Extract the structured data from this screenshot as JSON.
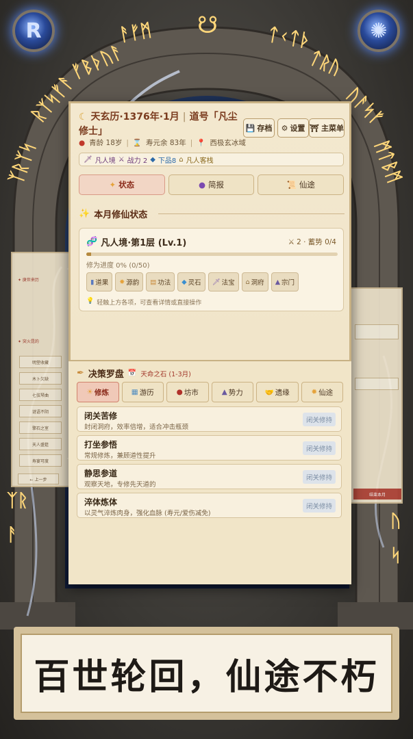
{
  "header": {
    "era": "天玄历·1376年·1月",
    "divider": "|",
    "title_label": "道号「凡尘修士」",
    "age": "青龄 18岁",
    "lifespan": "寿元余 83年",
    "location": "西极玄冰域",
    "buttons": {
      "save": "存档",
      "settings": "设置",
      "main_menu": "主菜单"
    }
  },
  "infobar": {
    "realm": "凡人境",
    "power": "战力 2",
    "spirit": "下品8",
    "residence": "凡人客栈"
  },
  "tabs": [
    "状态",
    "简报",
    "仙途"
  ],
  "section": {
    "title": "本月修仙状态"
  },
  "status_card": {
    "realm_level": "凡人境·第1层 (Lv.1)",
    "momentum": "2 · 蓄势 0/4",
    "progress_text": "修为进度 0% (0/50)",
    "progress_fraction": 0.0,
    "items": [
      "道果",
      "源韵",
      "功法",
      "灵石",
      "法宝",
      "洞府",
      "宗门"
    ],
    "hint": "轻触上方各项，可查看详情或直接操作"
  },
  "compass": {
    "title": "决策罗盘",
    "subtitle": "天命之石 (1-3月)",
    "tabs": [
      "修炼",
      "游历",
      "坊市",
      "势力",
      "遗缘",
      "仙途"
    ],
    "actions": [
      {
        "name": "闭关苦修",
        "desc": "封闭洞府，效率倍增，适合冲击瓶颈",
        "button": "闭关修持"
      },
      {
        "name": "打坐参悟",
        "desc": "常规修炼，兼顾道性提升",
        "button": "闭关修持"
      },
      {
        "name": "静思参道",
        "desc": "观察天地，专修先天道的",
        "button": "闭关修持"
      },
      {
        "name": "淬体炼体",
        "desc": "以灵气淬炼肉身，强化血脉 (寿元/爱伤减免)",
        "button": "闭关修持"
      }
    ]
  },
  "side_left": {
    "rows": [
      "明堂收藏",
      "木卜欠缺",
      "七弦琴曲",
      "谜语不阴",
      "擎石之室",
      "天人盛筵",
      "寿宴可度"
    ],
    "prev": "← 上一步"
  },
  "side_right": {
    "button": "结束本月"
  },
  "banner": {
    "text": "百世轮回，仙途不朽"
  },
  "colors": {
    "accent": "#8b2c1c",
    "parchment": "#f3e8cf",
    "gold_rune": "#ffd77a"
  }
}
